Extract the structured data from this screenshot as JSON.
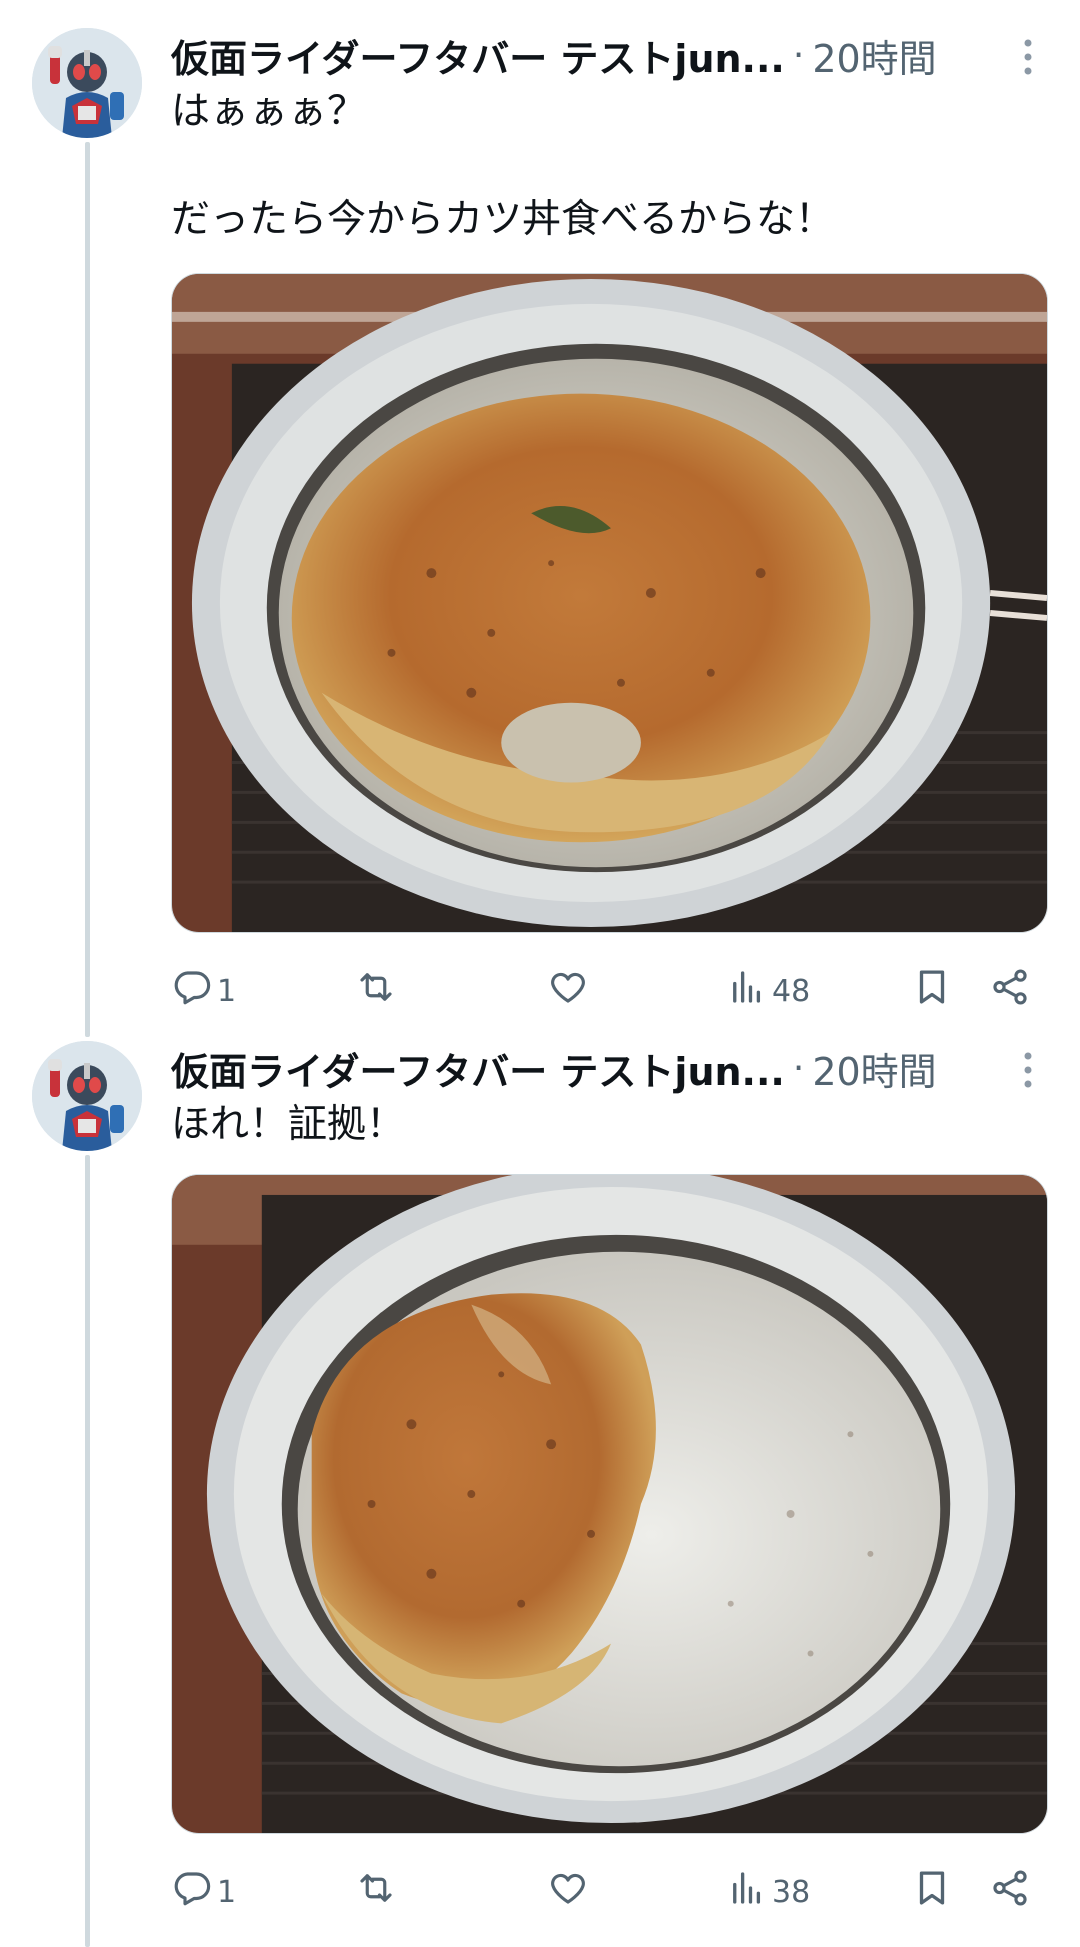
{
  "tweets": [
    {
      "author_name": "仮面ライダーフタバー テストjun...",
      "separator": "·",
      "time": "20時間",
      "text_lines": [
        "はぁぁぁ？",
        "",
        "だったら今からカツ丼食べるからな！"
      ],
      "replies": "1",
      "retweets": "",
      "likes": "",
      "views": "48",
      "media_description": "カツ丼の写真"
    },
    {
      "author_name": "仮面ライダーフタバー テストjun...",
      "separator": "·",
      "time": "20時間",
      "text_lines": [
        "ほれ！証拠！"
      ],
      "replies": "1",
      "retweets": "",
      "likes": "",
      "views": "38",
      "media_description": "食べかけのカツ丼の写真"
    }
  ],
  "colors": {
    "text_primary": "#0f1419",
    "text_secondary": "#536471",
    "thread_line": "#cfd9de"
  },
  "icons": [
    "reply-icon",
    "retweet-icon",
    "like-icon",
    "views-icon",
    "bookmark-icon",
    "share-icon",
    "more-icon"
  ]
}
